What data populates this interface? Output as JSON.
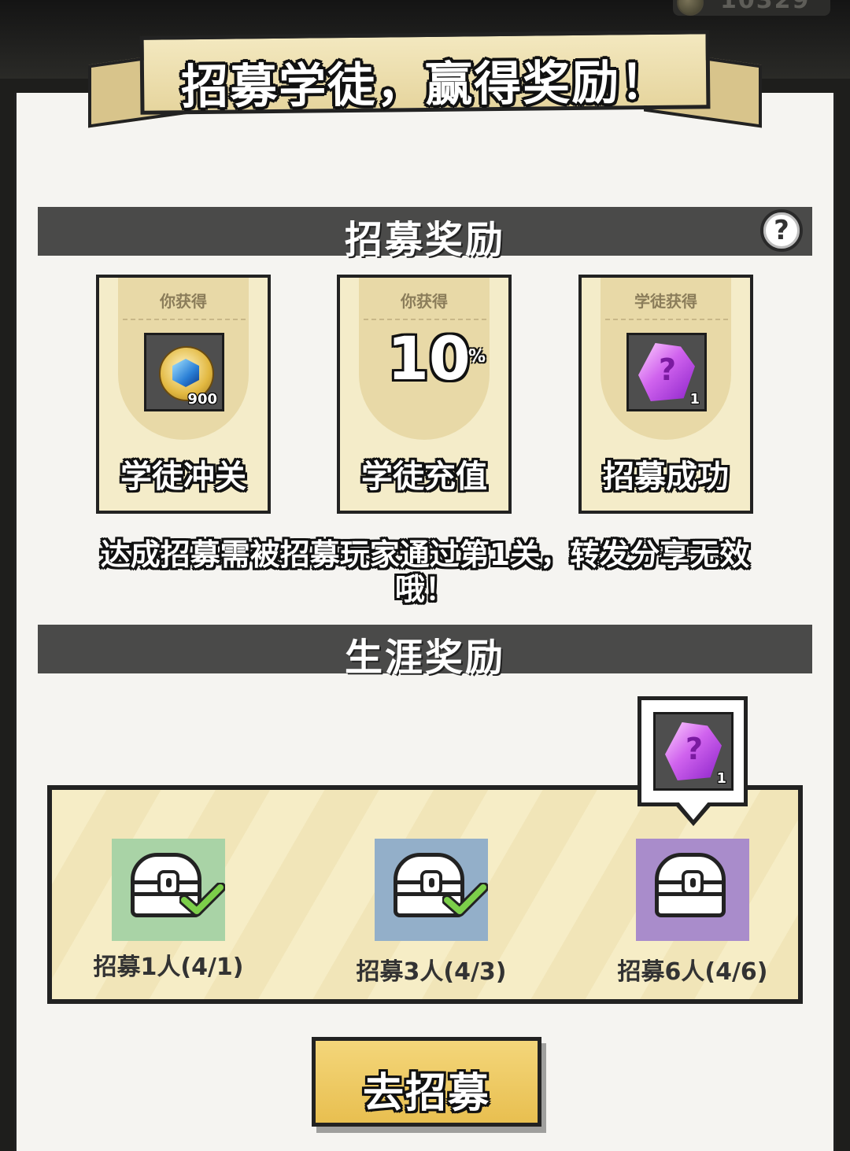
{
  "hud": {
    "coins": "10329"
  },
  "banner": {
    "title": "招募学徒，赢得奖励！"
  },
  "recruit_section": {
    "title": "招募奖励",
    "help_icon": "question-mark-icon",
    "cards": [
      {
        "caption": "你获得",
        "reward_icon": "gem-coin-icon",
        "reward_count": "900",
        "label": "学徒冲关"
      },
      {
        "caption": "你获得",
        "percent_value": "10",
        "percent_sign": "%",
        "label": "学徒充值"
      },
      {
        "caption": "学徒获得",
        "reward_icon": "mystery-crystal-icon",
        "reward_count": "1",
        "label": "招募成功"
      }
    ],
    "notice": "达成招募需被招募玩家通过第1关，转发分享无效哦！"
  },
  "career_section": {
    "title": "生涯奖励",
    "tiers": [
      {
        "label": "招募1人(4/1)",
        "color": "#a9d3a6",
        "completed": true,
        "icon": "chest-icon"
      },
      {
        "label": "招募3人(4/3)",
        "color": "#93afc9",
        "completed": true,
        "icon": "chest-icon"
      },
      {
        "label": "招募6人(4/6)",
        "color": "#a98ccb",
        "completed": false,
        "icon": "chest-icon"
      }
    ],
    "preview_reward": {
      "icon": "mystery-crystal-icon",
      "count": "1"
    }
  },
  "action": {
    "go_recruit_label": "去招募"
  }
}
